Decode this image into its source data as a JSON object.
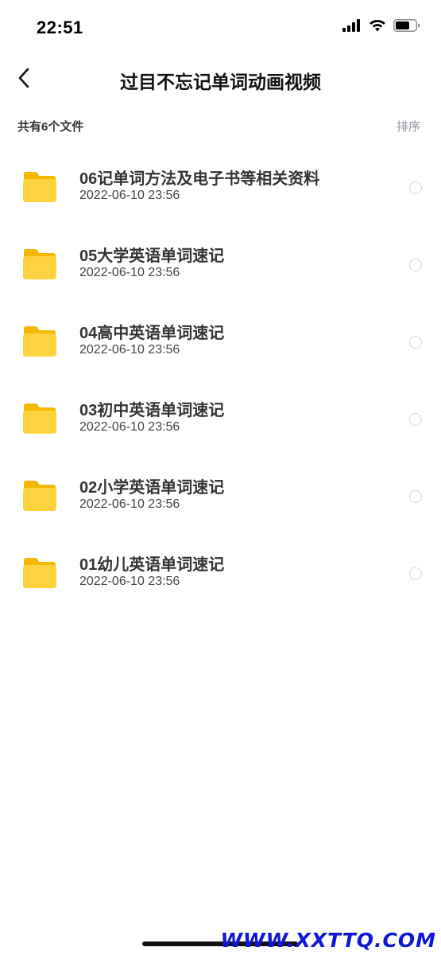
{
  "status_bar": {
    "time": "22:51",
    "icons": [
      "cellular-signal-icon",
      "wifi-icon",
      "battery-icon"
    ]
  },
  "nav": {
    "back_icon": "chevron-left-icon",
    "title": "过目不忘记单词动画视频"
  },
  "list_header": {
    "count_text": "共有6个文件",
    "sort_label": "排序"
  },
  "files": [
    {
      "name": "06记单词方法及电子书等相关资料",
      "date": "2022-06-10 23:56",
      "icon": "folder-icon"
    },
    {
      "name": "05大学英语单词速记",
      "date": "2022-06-10 23:56",
      "icon": "folder-icon"
    },
    {
      "name": "04高中英语单词速记",
      "date": "2022-06-10 23:56",
      "icon": "folder-icon"
    },
    {
      "name": "03初中英语单词速记",
      "date": "2022-06-10 23:56",
      "icon": "folder-icon"
    },
    {
      "name": "02小学英语单词速记",
      "date": "2022-06-10 23:56",
      "icon": "folder-icon"
    },
    {
      "name": "01幼儿英语单词速记",
      "date": "2022-06-10 23:56",
      "icon": "folder-icon"
    }
  ],
  "watermark": "WWW.XXTTQ.COM",
  "colors": {
    "folder": "#FFD23F",
    "folder_dark": "#F5B800",
    "muted_text": "#8a8f99",
    "watermark": "#1016d8"
  }
}
